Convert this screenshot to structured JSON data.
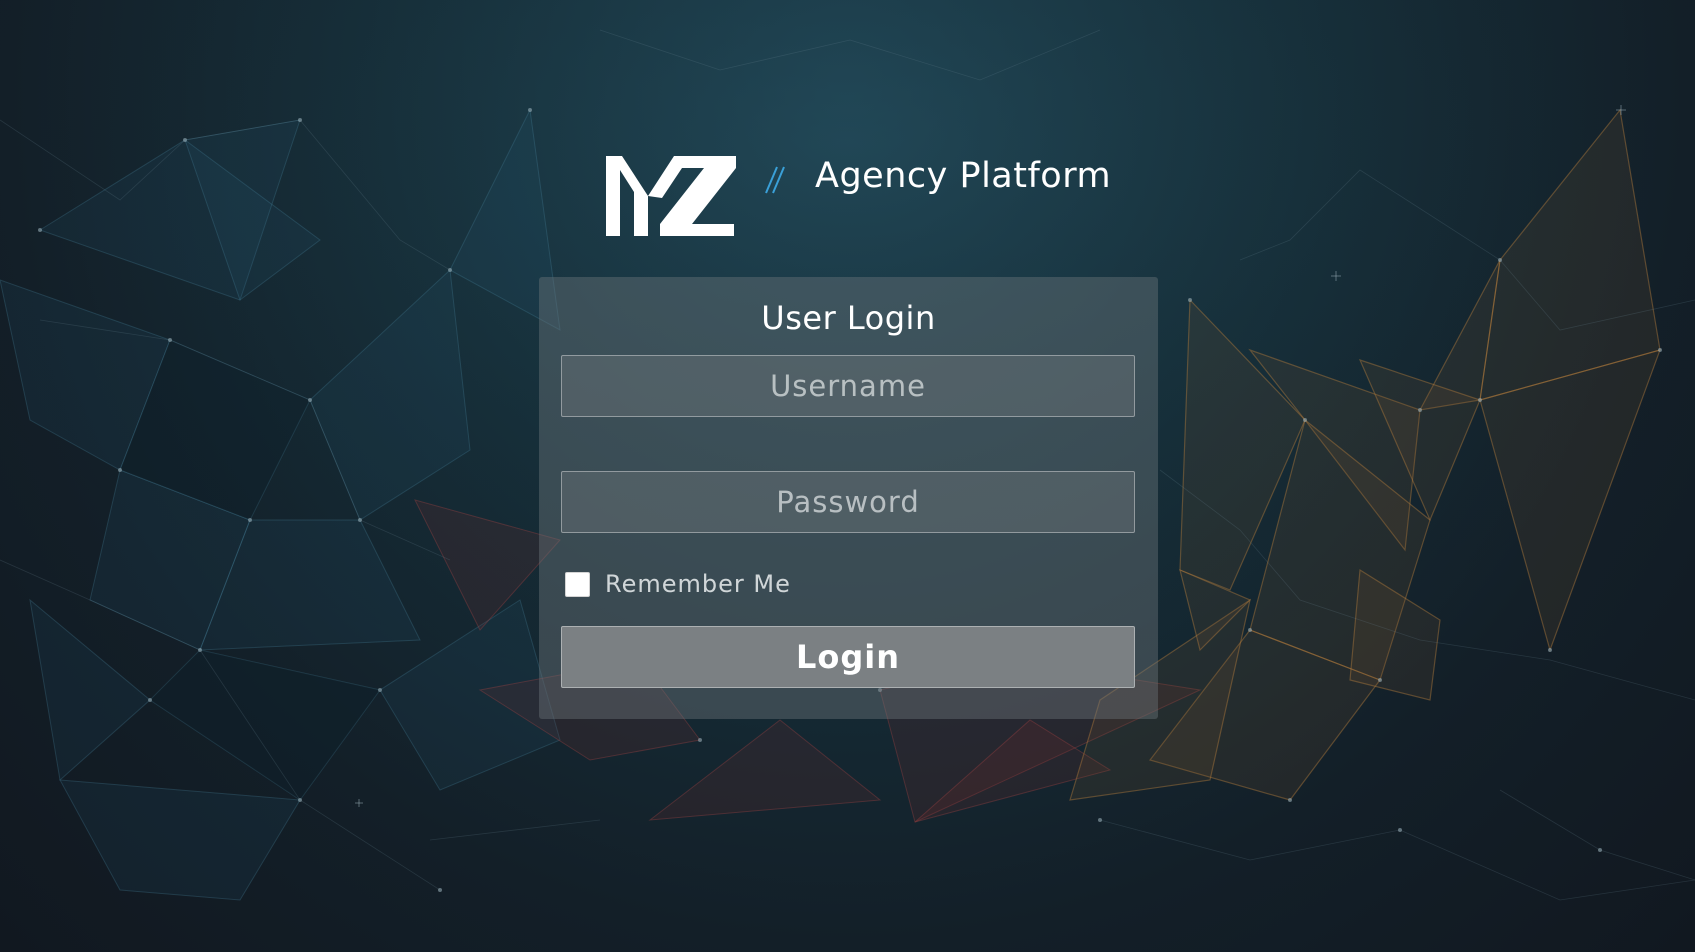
{
  "brand": {
    "logo_text": "MZ",
    "separator_icon": "double-slash-icon",
    "title": "Agency Platform",
    "accent_color": "#3aa0d8"
  },
  "login": {
    "title": "User Login",
    "username_placeholder": "Username",
    "username_value": "",
    "password_placeholder": "Password",
    "password_value": "",
    "remember_label": "Remember Me",
    "remember_checked": false,
    "submit_label": "Login"
  },
  "theme": {
    "background": "#16303b",
    "card_background": "rgba(110,118,124,0.42)",
    "button_background": "#7b8083"
  }
}
